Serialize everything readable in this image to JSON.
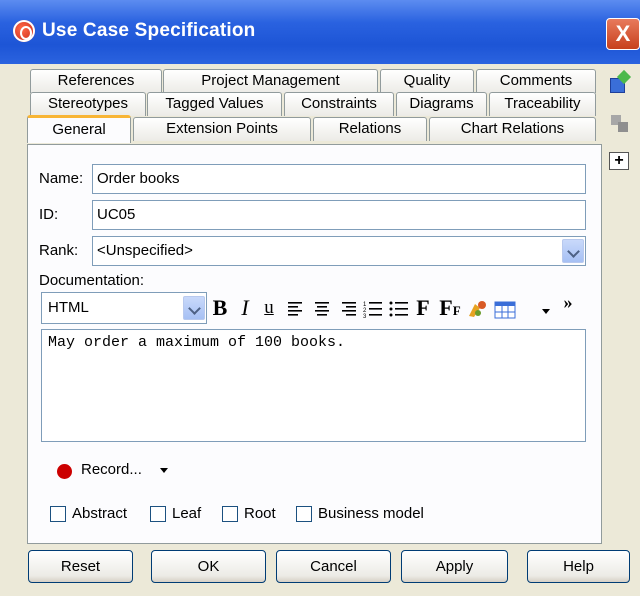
{
  "window": {
    "title": "Use Case Specification",
    "close_label": "X"
  },
  "tabs": {
    "row1": [
      "References",
      "Project Management",
      "Quality",
      "Comments"
    ],
    "row2": [
      "Stereotypes",
      "Tagged Values",
      "Constraints",
      "Diagrams",
      "Traceability"
    ],
    "row3": [
      "General",
      "Extension Points",
      "Relations",
      "Chart Relations"
    ],
    "active": "General"
  },
  "side_tools": [
    "edit-icon",
    "copy-icon",
    "expand-icon"
  ],
  "form": {
    "name_label": "Name:",
    "name_value": "Order books",
    "id_label": "ID:",
    "id_value": "UC05",
    "rank_label": "Rank:",
    "rank_value": "<Unspecified>",
    "documentation_label": "Documentation:"
  },
  "editor": {
    "format_value": "HTML",
    "bold": "B",
    "italic": "I",
    "underline": "u",
    "font": "F",
    "font_size": "F",
    "more": "»",
    "content": "May order a maximum of 100 books."
  },
  "record": {
    "label": "Record..."
  },
  "checkboxes": {
    "abstract": "Abstract",
    "leaf": "Leaf",
    "root": "Root",
    "business_model": "Business model"
  },
  "buttons": {
    "reset": "Reset",
    "ok": "OK",
    "cancel": "Cancel",
    "apply": "Apply",
    "help": "Help"
  }
}
